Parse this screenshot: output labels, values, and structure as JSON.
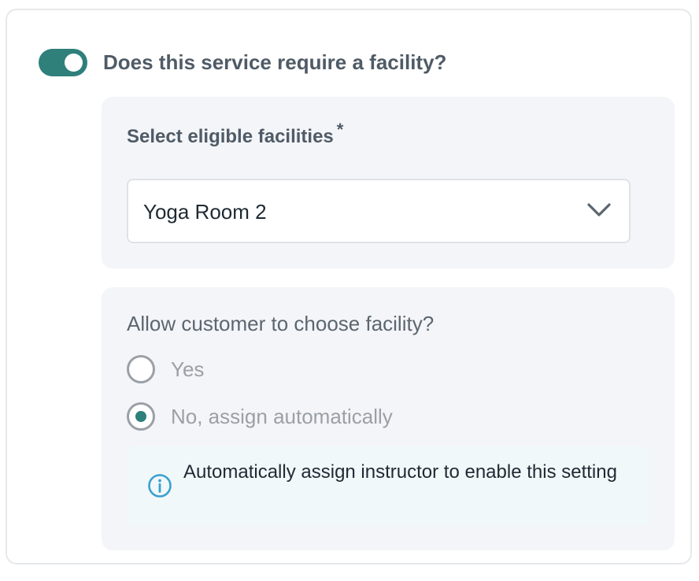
{
  "facility_toggle": {
    "enabled": true,
    "question": "Does this service require a facility?"
  },
  "facility_select": {
    "label": "Select eligible facilities",
    "required_marker": "*",
    "selected": "Yoga Room 2"
  },
  "customer_choice": {
    "question": "Allow customer to choose facility?",
    "options": [
      {
        "label": "Yes",
        "selected": false
      },
      {
        "label": "No, assign automatically",
        "selected": true
      }
    ],
    "info_message": "Automatically assign instructor to enable this setting"
  },
  "colors": {
    "accent": "#2f7f7b",
    "panel_bg": "#f4f5f9",
    "info_bg": "#f1f8fa",
    "info_icon": "#3aa0d0",
    "disabled_text": "#9aa0a6"
  },
  "icons": {
    "dropdown": "chevron-down-icon",
    "info": "info-icon"
  }
}
